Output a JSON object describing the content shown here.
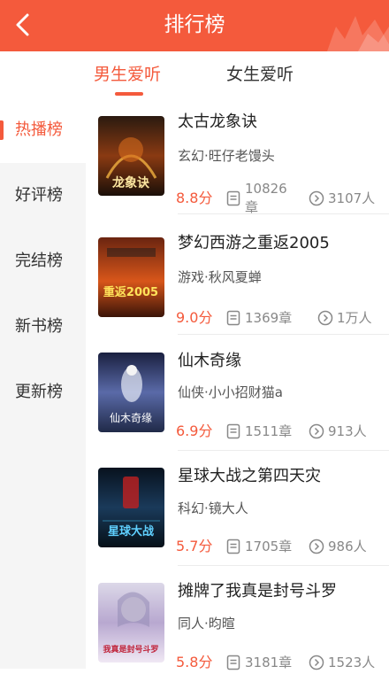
{
  "header": {
    "title": "排行榜"
  },
  "tabs": [
    {
      "label": "男生爱听",
      "active": true
    },
    {
      "label": "女生爱听",
      "active": false
    }
  ],
  "sidebar": {
    "items": [
      {
        "label": "热播榜",
        "active": true
      },
      {
        "label": "好评榜",
        "active": false
      },
      {
        "label": "完结榜",
        "active": false
      },
      {
        "label": "新书榜",
        "active": false
      },
      {
        "label": "更新榜",
        "active": false
      }
    ]
  },
  "books": [
    {
      "title": "太古龙象诀",
      "meta": "玄幻·旺仔老馒头",
      "score": "8.8分",
      "chapters": "10826章",
      "reads": "3107人",
      "cover_text": "龙象诀"
    },
    {
      "title": "梦幻西游之重返2005",
      "meta": "游戏·秋风夏蝉",
      "score": "9.0分",
      "chapters": "1369章",
      "reads": "1万人",
      "cover_text": "重返2005"
    },
    {
      "title": "仙木奇缘",
      "meta": "仙侠·小小招财猫a",
      "score": "6.9分",
      "chapters": "1511章",
      "reads": "913人",
      "cover_text": "仙木奇缘"
    },
    {
      "title": "星球大战之第四天灾",
      "meta": "科幻·镜大人",
      "score": "5.7分",
      "chapters": "1705章",
      "reads": "986人",
      "cover_text": "星球大战"
    },
    {
      "title": "摊牌了我真是封号斗罗",
      "meta": "同人·昀暄",
      "score": "5.8分",
      "chapters": "3181章",
      "reads": "1523人",
      "cover_text": "我真是封号斗罗"
    }
  ],
  "colors": {
    "accent": "#f45a3c",
    "sidebar_bg": "#f5f5f5"
  },
  "icons": {
    "back": "chevron-left-icon",
    "chapters": "document-icon",
    "reads": "play-circle-icon"
  }
}
